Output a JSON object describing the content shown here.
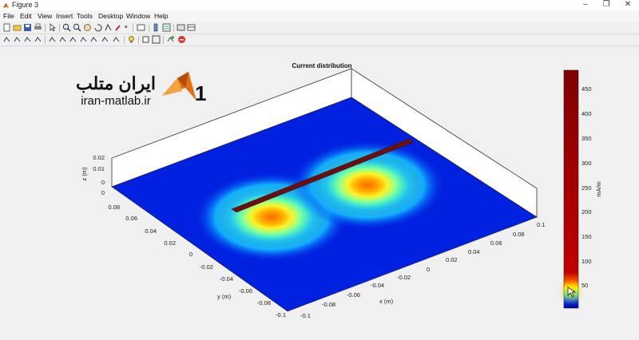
{
  "window": {
    "title": "Figure 3"
  },
  "menu": [
    "File",
    "Edit",
    "View",
    "Insert",
    "Tools",
    "Desktop",
    "Window",
    "Help"
  ],
  "watermark": {
    "persian": "ایران متلب",
    "latin": "iran-matlab.ir"
  },
  "plot": {
    "title": "Current distribution",
    "xlabel": "x (m)",
    "ylabel": "y (m)",
    "zlabel": "z (m)",
    "x_ticks": [
      "-0.1",
      "-0.08",
      "-0.06",
      "-0.04",
      "-0.02",
      "0",
      "0.02",
      "0.04",
      "0.06",
      "0.08",
      "0.1"
    ],
    "y_ticks": [
      "-0.1",
      "-0.08",
      "-0.06",
      "-0.04",
      "-0.02",
      "0",
      "0.02",
      "0.04",
      "0.06",
      "0.08",
      "0.1"
    ],
    "z_ticks": [
      "0",
      "0.01",
      "0.02"
    ]
  },
  "colorbar": {
    "label": "mA/m",
    "ticks": [
      "50",
      "100",
      "150",
      "200",
      "250",
      "300",
      "350",
      "400",
      "450"
    ]
  },
  "colors": {
    "titlebar": "#ffffff",
    "background": "#f0f0f0",
    "colormap_top": "#800000",
    "colormap_bottom": "#00008f"
  }
}
